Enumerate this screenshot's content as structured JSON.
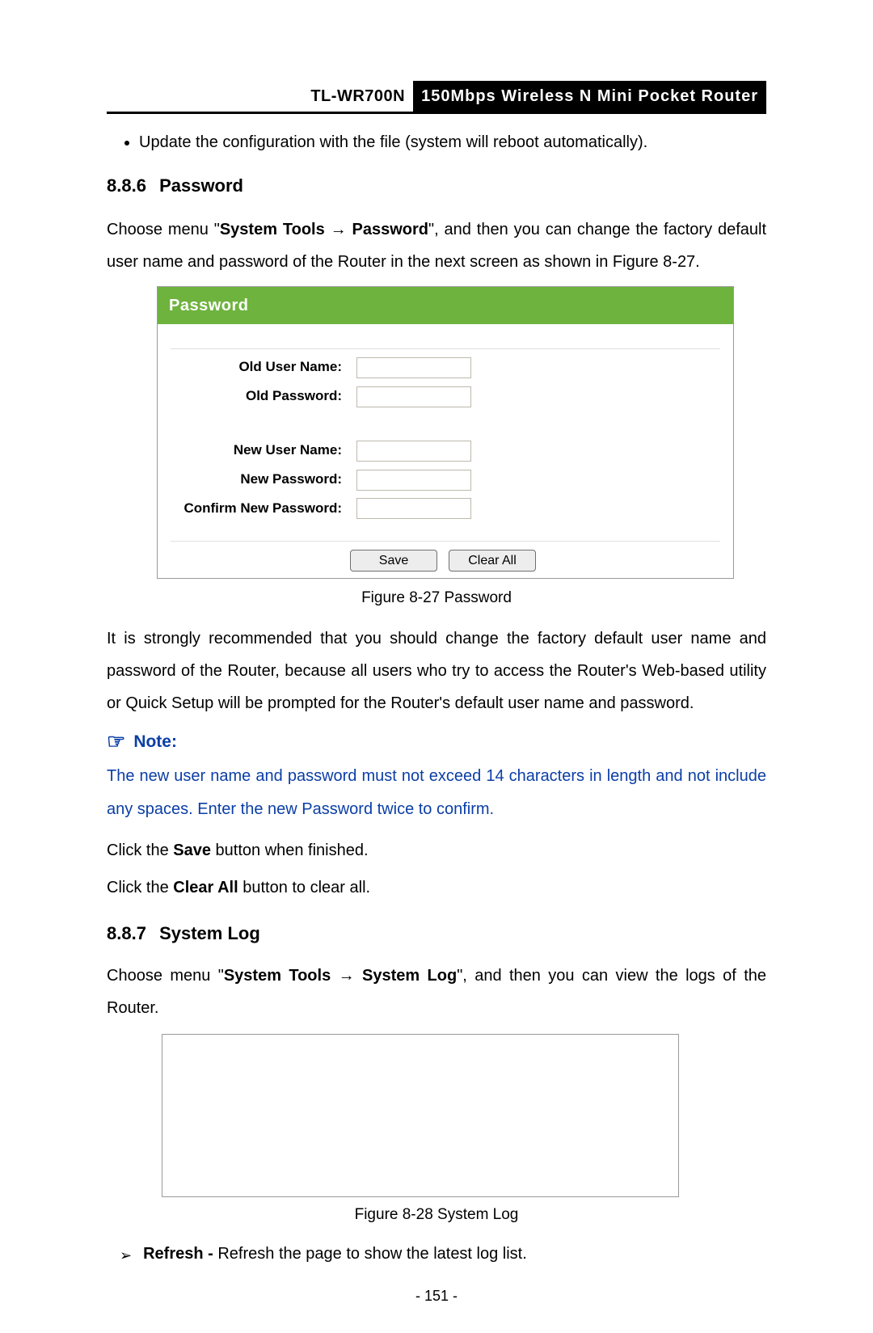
{
  "header": {
    "model": "TL-WR700N",
    "product": "150Mbps Wireless N Mini Pocket Router"
  },
  "bullet1": "Update the configuration with the file (system will reboot automatically).",
  "section_password": {
    "num": "8.8.6",
    "title": "Password",
    "intro_pre": "Choose menu \"",
    "nav1": "System Tools",
    "nav2": "Password",
    "intro_post": "\", and then you can change the factory default user name and password of the Router in the next screen as shown in Figure 8-27."
  },
  "figure_password": {
    "panel_title": "Password",
    "labels": {
      "old_user": "Old User Name:",
      "old_pass": "Old Password:",
      "new_user": "New User Name:",
      "new_pass": "New Password:",
      "confirm_pass": "Confirm New Password:"
    },
    "buttons": {
      "save": "Save",
      "clear": "Clear All"
    },
    "caption": "Figure 8-27    Password"
  },
  "para_recommend": "It is strongly recommended that you should change the factory default user name and password of the Router, because all users who try to access the Router's Web-based utility or Quick Setup will be prompted for the Router's default user name and password.",
  "note": {
    "label": "Note:",
    "body": "The new user name and password must not exceed 14 characters in length and not include any spaces. Enter the new Password twice to confirm."
  },
  "click_save_pre": "Click the ",
  "click_save_bold": "Save",
  "click_save_post": " button when finished.",
  "click_clear_pre": "Click the ",
  "click_clear_bold": "Clear All",
  "click_clear_post": " button to clear all.",
  "section_syslog": {
    "num": "8.8.7",
    "title": "System Log",
    "intro_pre": "Choose menu \"",
    "nav1": "System Tools",
    "nav2": "System Log",
    "intro_post": "\", and then you can view the logs of the Router."
  },
  "figure_syslog": {
    "caption": "Figure 8-28    System Log"
  },
  "refresh_line": {
    "bold": "Refresh -",
    "rest": " Refresh the page to show the latest log list."
  },
  "page_number": "- 151 -"
}
